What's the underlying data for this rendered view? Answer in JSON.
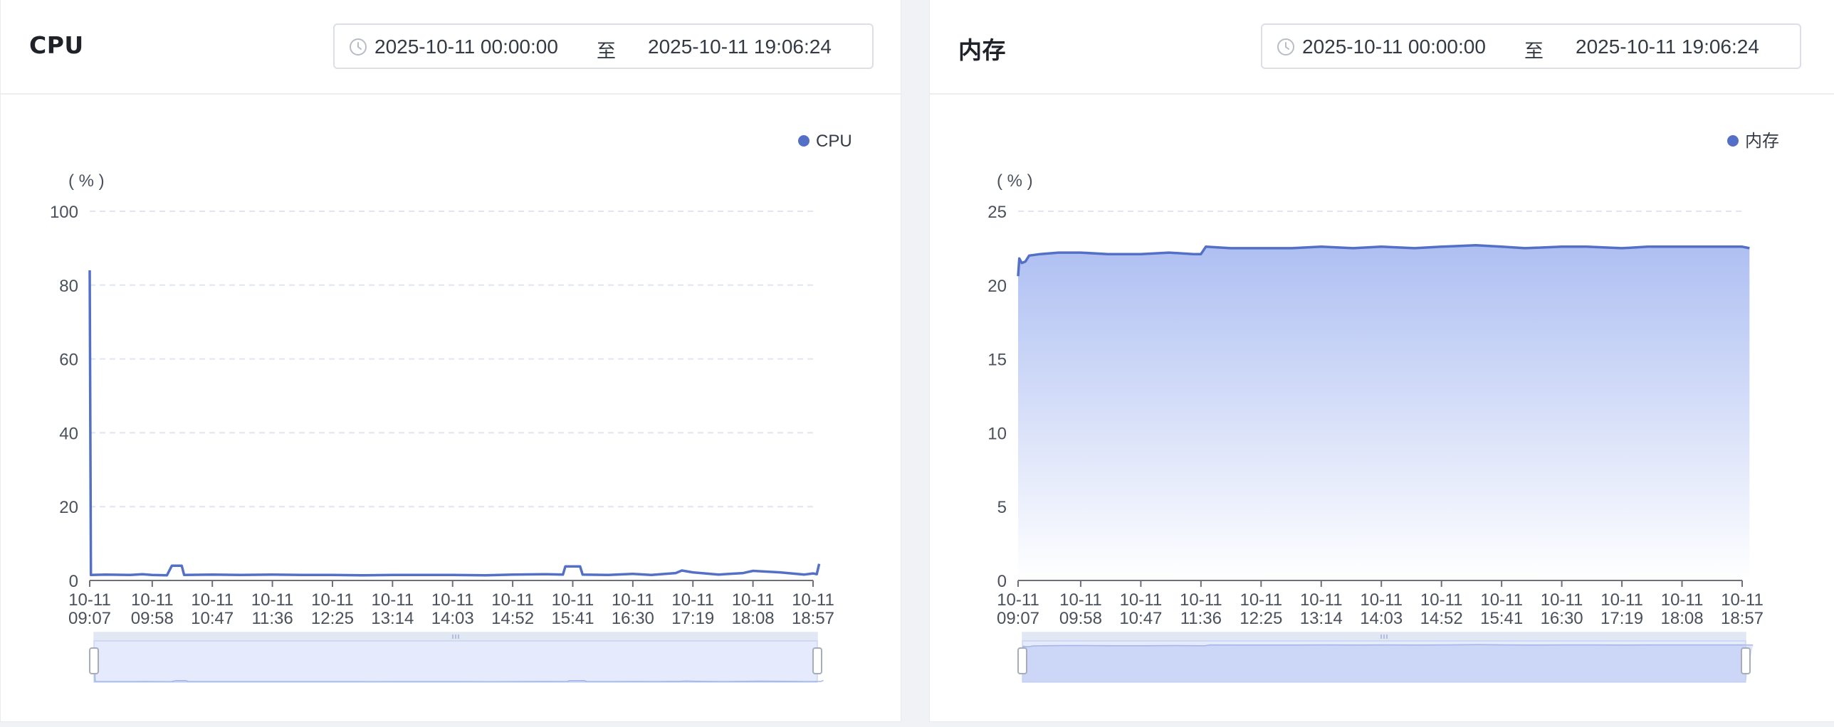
{
  "cpu_panel": {
    "title": "CPU",
    "date_range": {
      "start": "2025-10-11 00:00:00",
      "separator": "至",
      "end": "2025-10-11 19:06:24"
    },
    "icon": "clock-icon"
  },
  "mem_panel": {
    "title": "内存",
    "date_range": {
      "start": "2025-10-11 00:00:00",
      "separator": "至",
      "end": "2025-10-11 19:06:24"
    },
    "icon": "clock-icon"
  },
  "colors": {
    "series": "#5470c6",
    "grid": "#e0e6f1",
    "axis": "#6e7079",
    "slider_fill": "#d7e0f8"
  },
  "chart_data": [
    {
      "type": "line",
      "title": "",
      "legend": [
        "CPU"
      ],
      "legend_position": "top-right",
      "ylabel": "( % )",
      "ylim": [
        0,
        100
      ],
      "yticks": [
        "0",
        "20",
        "40",
        "60",
        "80",
        "100"
      ],
      "x_ticks": [
        [
          "10-11",
          "09:07"
        ],
        [
          "10-11",
          "09:58"
        ],
        [
          "10-11",
          "10:47"
        ],
        [
          "10-11",
          "11:36"
        ],
        [
          "10-11",
          "12:25"
        ],
        [
          "10-11",
          "13:14"
        ],
        [
          "10-11",
          "14:03"
        ],
        [
          "10-11",
          "14:52"
        ],
        [
          "10-11",
          "15:41"
        ],
        [
          "10-11",
          "16:30"
        ],
        [
          "10-11",
          "17:19"
        ],
        [
          "10-11",
          "18:08"
        ],
        [
          "10-11",
          "18:57"
        ]
      ],
      "grid": true,
      "area": false,
      "series": [
        {
          "name": "CPU",
          "points": [
            [
              "09:07",
              84
            ],
            [
              "09:08",
              1.5
            ],
            [
              "09:20",
              1.6
            ],
            [
              "09:40",
              1.5
            ],
            [
              "09:50",
              1.7
            ],
            [
              "09:58",
              1.5
            ],
            [
              "10:10",
              1.4
            ],
            [
              "10:14",
              4.0
            ],
            [
              "10:22",
              4.0
            ],
            [
              "10:24",
              1.5
            ],
            [
              "10:47",
              1.6
            ],
            [
              "11:10",
              1.5
            ],
            [
              "11:36",
              1.6
            ],
            [
              "12:00",
              1.5
            ],
            [
              "12:25",
              1.5
            ],
            [
              "12:50",
              1.4
            ],
            [
              "13:14",
              1.5
            ],
            [
              "13:40",
              1.5
            ],
            [
              "14:03",
              1.5
            ],
            [
              "14:30",
              1.4
            ],
            [
              "14:52",
              1.6
            ],
            [
              "15:20",
              1.7
            ],
            [
              "15:33",
              1.6
            ],
            [
              "15:35",
              3.8
            ],
            [
              "15:47",
              3.8
            ],
            [
              "15:49",
              1.6
            ],
            [
              "16:10",
              1.5
            ],
            [
              "16:30",
              1.8
            ],
            [
              "16:45",
              1.5
            ],
            [
              "17:05",
              2.0
            ],
            [
              "17:10",
              2.7
            ],
            [
              "17:19",
              2.2
            ],
            [
              "17:40",
              1.6
            ],
            [
              "18:00",
              2.0
            ],
            [
              "18:08",
              2.6
            ],
            [
              "18:30",
              2.2
            ],
            [
              "18:50",
              1.6
            ],
            [
              "18:57",
              1.9
            ],
            [
              "19:00",
              1.7
            ],
            [
              "19:02",
              4.5
            ]
          ]
        }
      ]
    },
    {
      "type": "area",
      "title": "",
      "legend": [
        "内存"
      ],
      "legend_position": "top-right",
      "ylabel": "( % )",
      "ylim": [
        0,
        25
      ],
      "yticks": [
        "0",
        "5",
        "10",
        "15",
        "20",
        "25"
      ],
      "x_ticks": [
        [
          "10-11",
          "09:07"
        ],
        [
          "10-11",
          "09:58"
        ],
        [
          "10-11",
          "10:47"
        ],
        [
          "10-11",
          "11:36"
        ],
        [
          "10-11",
          "12:25"
        ],
        [
          "10-11",
          "13:14"
        ],
        [
          "10-11",
          "14:03"
        ],
        [
          "10-11",
          "14:52"
        ],
        [
          "10-11",
          "15:41"
        ],
        [
          "10-11",
          "16:30"
        ],
        [
          "10-11",
          "17:19"
        ],
        [
          "10-11",
          "18:08"
        ],
        [
          "10-11",
          "18:57"
        ]
      ],
      "grid": true,
      "area": true,
      "series": [
        {
          "name": "内存",
          "points": [
            [
              "09:07",
              20.6
            ],
            [
              "09:08",
              21.8
            ],
            [
              "09:10",
              21.5
            ],
            [
              "09:13",
              21.6
            ],
            [
              "09:16",
              22.0
            ],
            [
              "09:25",
              22.1
            ],
            [
              "09:40",
              22.2
            ],
            [
              "09:58",
              22.2
            ],
            [
              "10:20",
              22.1
            ],
            [
              "10:47",
              22.1
            ],
            [
              "11:10",
              22.2
            ],
            [
              "11:30",
              22.1
            ],
            [
              "11:36",
              22.1
            ],
            [
              "11:40",
              22.6
            ],
            [
              "12:00",
              22.5
            ],
            [
              "12:25",
              22.5
            ],
            [
              "12:50",
              22.5
            ],
            [
              "13:14",
              22.6
            ],
            [
              "13:40",
              22.5
            ],
            [
              "14:03",
              22.6
            ],
            [
              "14:30",
              22.5
            ],
            [
              "14:52",
              22.6
            ],
            [
              "15:20",
              22.7
            ],
            [
              "15:41",
              22.6
            ],
            [
              "16:00",
              22.5
            ],
            [
              "16:30",
              22.6
            ],
            [
              "16:50",
              22.6
            ],
            [
              "17:19",
              22.5
            ],
            [
              "17:40",
              22.6
            ],
            [
              "18:08",
              22.6
            ],
            [
              "18:30",
              22.6
            ],
            [
              "18:57",
              22.6
            ],
            [
              "19:03",
              22.5
            ]
          ]
        }
      ]
    }
  ]
}
